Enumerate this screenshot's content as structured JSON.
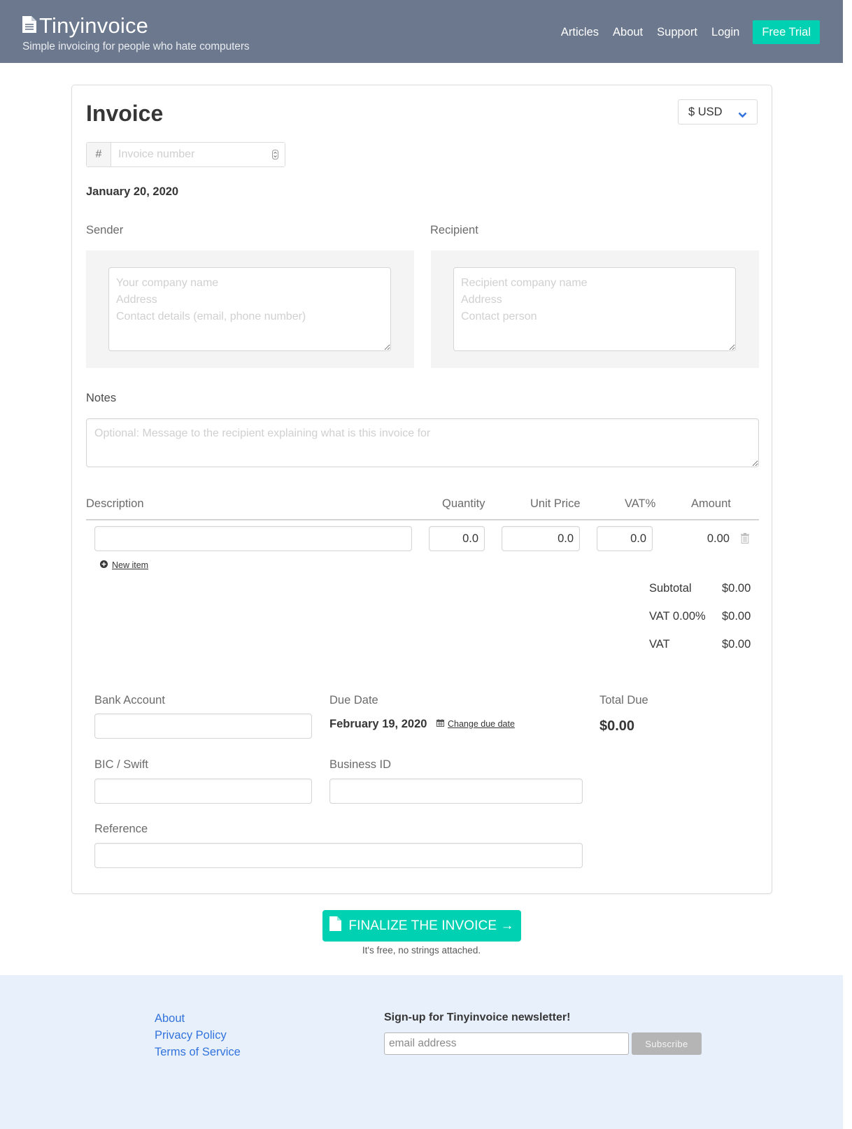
{
  "header": {
    "brand": "Tinyinvoice",
    "tagline": "Simple invoicing for people who hate computers",
    "nav": [
      "Articles",
      "About",
      "Support",
      "Login"
    ],
    "cta": "Free Trial"
  },
  "invoice": {
    "title": "Invoice",
    "currency": "$ USD",
    "number_prefix": "#",
    "number_placeholder": "Invoice number",
    "date": "January 20, 2020",
    "sender": {
      "label": "Sender",
      "placeholder": "Your company name\nAddress\nContact details (email, phone number)"
    },
    "recipient": {
      "label": "Recipient",
      "placeholder": "Recipient company name\nAddress\nContact person"
    },
    "notes": {
      "label": "Notes",
      "placeholder": "Optional: Message to the recipient explaining what is this invoice for"
    },
    "items": {
      "columns": [
        "Description",
        "Quantity",
        "Unit Price",
        "VAT%",
        "Amount"
      ],
      "rows": [
        {
          "description": "",
          "quantity": "0.0",
          "unit_price": "0.0",
          "vat": "0.0",
          "amount": "0.00"
        }
      ],
      "new_item": "New item"
    },
    "totals": [
      {
        "label": "Subtotal",
        "value": "$0.00"
      },
      {
        "label": "VAT 0.00%",
        "value": "$0.00"
      },
      {
        "label": "VAT",
        "value": "$0.00"
      }
    ],
    "payment": {
      "bank_account_label": "Bank Account",
      "bank_account_value": "",
      "due_date_label": "Due Date",
      "due_date": "February 19, 2020",
      "change_due_date": "Change due date",
      "total_due_label": "Total Due",
      "total_due": "$0.00",
      "bic_label": "BIC / Swift",
      "bic_value": "",
      "business_id_label": "Business ID",
      "business_id_value": "",
      "reference_label": "Reference",
      "reference_value": ""
    }
  },
  "finalize": {
    "label": "FINALIZE THE INVOICE →",
    "note": "It's free, no strings attached."
  },
  "footer": {
    "links": [
      "About",
      "Privacy Policy",
      "Terms of Service"
    ],
    "newsletter_title": "Sign-up for Tinyinvoice newsletter!",
    "email_placeholder": "email address",
    "subscribe": "Subscribe"
  },
  "colors": {
    "header_bg": "#6b788d",
    "accent": "#00d1b2",
    "link": "#3273dc",
    "footer_bg": "#e8f0fb"
  }
}
